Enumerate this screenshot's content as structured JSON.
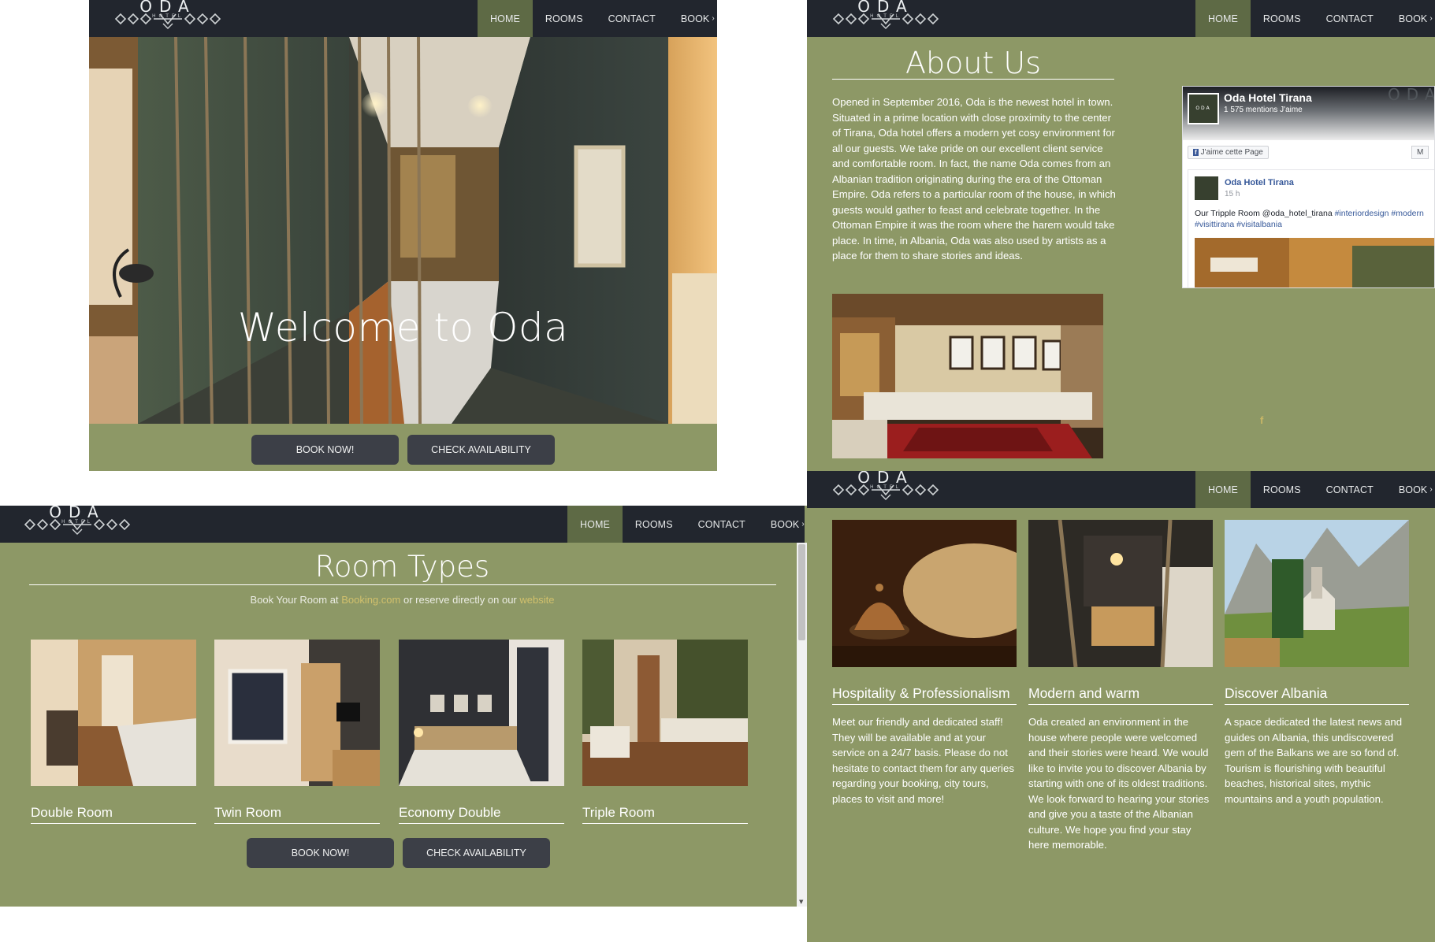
{
  "logo": {
    "text": "ODA",
    "sub": "HOTEL"
  },
  "nav": {
    "items": [
      "HOME",
      "ROOMS",
      "CONTACT",
      "BOOK"
    ]
  },
  "colors": {
    "panel_green": "#8d9866",
    "topbar": "#22262e",
    "nav_active": "#5e6a45",
    "button": "#3c3f47",
    "link": "#d1c06c"
  },
  "home": {
    "title": "Welcome to Oda",
    "book_now": "BOOK NOW!",
    "check_availability": "CHECK AVAILABILITY"
  },
  "about": {
    "title": "About Us",
    "text": "Opened in September 2016, Oda is the newest hotel in town. Situated in a prime location with close proximity to the center of Tirana, Oda hotel offers a modern yet cosy environment for all our guests. We take pride on our excellent client service and comfortable room. In fact, the name Oda comes from an Albanian tradition originating during the era of the Ottoman Empire. Oda refers to a particular room of the house, in which guests would gather to feast and celebrate together. In the Ottoman Empire it was the room where the harem would take place. In time, in Albania, Oda was also used by artists as a place for them to share stories and ideas.",
    "facebook_icon": "f",
    "fb": {
      "page_name": "Oda Hotel Tirana",
      "likes": "1 575 mentions J'aime",
      "brand": "ODA",
      "like_button": "J'aime cette Page",
      "message_button": "M",
      "post_name": "Oda Hotel Tirana",
      "post_time": "15 h",
      "post_text": "Our Tripple Room @oda_hotel_tirana",
      "post_tag1": "#interiordesign",
      "post_tag2": "#modern",
      "post_tag3": "#visittirana",
      "post_tag4": "#visitalbania"
    }
  },
  "rooms": {
    "title": "Room Types",
    "subtitle_pre": "Book Your Room at",
    "subtitle_link1": "Booking.com",
    "subtitle_mid": "or reserve directly on our",
    "subtitle_link2": "website",
    "items": [
      "Double Room",
      "Twin Room",
      "Economy Double",
      "Triple Room"
    ],
    "book_now": "BOOK NOW!",
    "check_availability": "CHECK AVAILABILITY"
  },
  "features": {
    "items": [
      {
        "title": "Hospitality & Professionalism",
        "text": "Meet our friendly and dedicated staff! They will be available and at your service on a 24/7 basis. Please do not hesitate to contact them for any queries regarding your booking, city tours, places to visit and more!"
      },
      {
        "title": "Modern and warm",
        "text": "Oda created an environment in the house where people were welcomed and their stories were heard. We would like to invite you to discover Albania by starting with one of its oldest traditions. We look forward to hearing your stories and give you a taste of the Albanian culture. We hope you find your stay here memorable."
      },
      {
        "title": "Discover Albania",
        "text": "A space dedicated the latest news and guides on Albania, this undiscovered gem of the Balkans we are so fond of. Tourism is flourishing with beautiful beaches, historical sites, mythic mountains and a youth population."
      }
    ]
  }
}
